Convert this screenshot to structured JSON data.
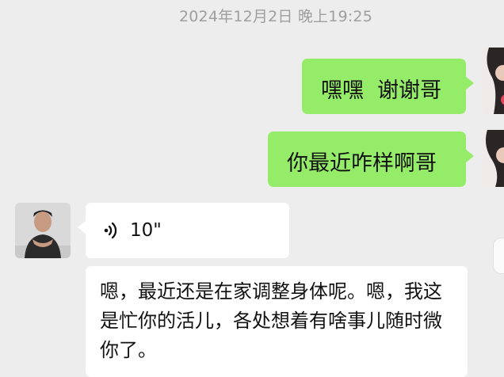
{
  "chat": {
    "timestamp": "2024年12月2日 晚上19:25",
    "messages": [
      {
        "id": "m1",
        "side": "out",
        "text": "嘿嘿  谢谢哥"
      },
      {
        "id": "m2",
        "side": "out",
        "text": "你最近咋样啊哥"
      },
      {
        "id": "m3",
        "side": "in",
        "type": "voice",
        "duration": "10\""
      },
      {
        "id": "m4",
        "side": "in",
        "text": "嗯，最近还是在家调整身体呢。嗯，我这是忙你的活儿，各处想着有啥事儿随时微你了。"
      }
    ]
  },
  "colors": {
    "chat_background": "#ededed",
    "outgoing_bubble": "#95ec69",
    "incoming_bubble": "#ffffff",
    "timestamp_text": "#9e9e9e"
  },
  "icons": {
    "voice": "voice-wave-icon",
    "avatar_friend": "avatar",
    "avatar_self": "avatar"
  }
}
